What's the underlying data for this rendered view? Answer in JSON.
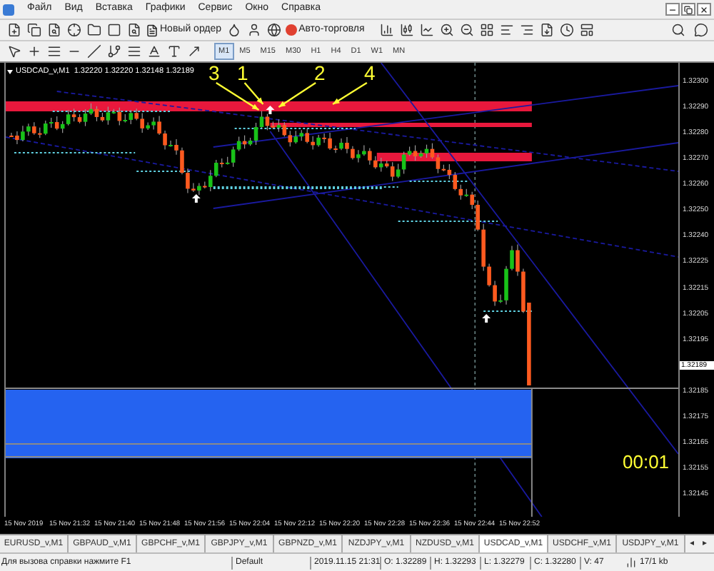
{
  "menu": [
    "Файл",
    "Вид",
    "Вставка",
    "Графики",
    "Сервис",
    "Окно",
    "Справка"
  ],
  "toolbar": {
    "new_order": "Новый ордер",
    "auto_trading": "Авто-торговля"
  },
  "timeframes": [
    {
      "label": "M1",
      "selected": true
    },
    {
      "label": "M5",
      "selected": false
    },
    {
      "label": "M15",
      "selected": false
    },
    {
      "label": "M30",
      "selected": false
    },
    {
      "label": "H1",
      "selected": false
    },
    {
      "label": "H4",
      "selected": false
    },
    {
      "label": "D1",
      "selected": false
    },
    {
      "label": "W1",
      "selected": false
    },
    {
      "label": "MN",
      "selected": false
    }
  ],
  "chart": {
    "header": "USDCAD_v,M1  1.32220 1.32220 1.32148 1.32189",
    "annotations": [
      "3",
      "1",
      "2",
      "4"
    ],
    "price_labels": [
      {
        "text": "1.32300",
        "kind": "tick"
      },
      {
        "text": "1.32290",
        "kind": "tick"
      },
      {
        "text": "1.32280",
        "kind": "tick"
      },
      {
        "text": "1.32270",
        "kind": "tick"
      },
      {
        "text": "1.32260",
        "kind": "tick"
      },
      {
        "text": "1.32250",
        "kind": "tick"
      },
      {
        "text": "1.32240",
        "kind": "tick"
      },
      {
        "text": "1.32225",
        "kind": "tick"
      },
      {
        "text": "1.32215",
        "kind": "tick"
      },
      {
        "text": "1.32205",
        "kind": "tick"
      },
      {
        "text": "1.32195",
        "kind": "tick"
      },
      {
        "text": "1.32189",
        "kind": "current"
      },
      {
        "text": "1.32185",
        "kind": "tick"
      },
      {
        "text": "1.32175",
        "kind": "tick"
      },
      {
        "text": "1.32165",
        "kind": "tick"
      },
      {
        "text": "1.32155",
        "kind": "tick"
      },
      {
        "text": "1.32145",
        "kind": "tick"
      }
    ],
    "time_labels": [
      "15 Nov 2019",
      "15 Nov 21:32",
      "15 Nov 21:40",
      "15 Nov 21:48",
      "15 Nov 21:56",
      "15 Nov 22:04",
      "15 Nov 22:12",
      "15 Nov 22:20",
      "15 Nov 22:28",
      "15 Nov 22:36",
      "15 Nov 22:44",
      "15 Nov 22:52"
    ],
    "timer": "00:01"
  },
  "symbol_tabs": [
    {
      "label": "EURUSD_v,M1",
      "selected": false
    },
    {
      "label": "GBPAUD_v,M1",
      "selected": false
    },
    {
      "label": "GBPCHF_v,M1",
      "selected": false
    },
    {
      "label": "GBPJPY_v,M1",
      "selected": false
    },
    {
      "label": "GBPNZD_v,M1",
      "selected": false
    },
    {
      "label": "NZDJPY_v,M1",
      "selected": false
    },
    {
      "label": "NZDUSD_v,M1",
      "selected": false
    },
    {
      "label": "USDCAD_v,M1",
      "selected": true
    },
    {
      "label": "USDCHF_v,M1",
      "selected": false
    },
    {
      "label": "USDJPY_v,M1",
      "selected": false
    }
  ],
  "tab_scroll": [
    "◂",
    "▸"
  ],
  "status_bar": {
    "help": "Для вызова справки нажмите F1",
    "profile": "Default",
    "time": "2019.11.15 21:31",
    "open": "O: 1.32289",
    "high": "H: 1.32293",
    "low": "L: 1.32279",
    "close": "C: 1.32280",
    "volume": "V: 47",
    "traffic": "17/1 kb"
  }
}
